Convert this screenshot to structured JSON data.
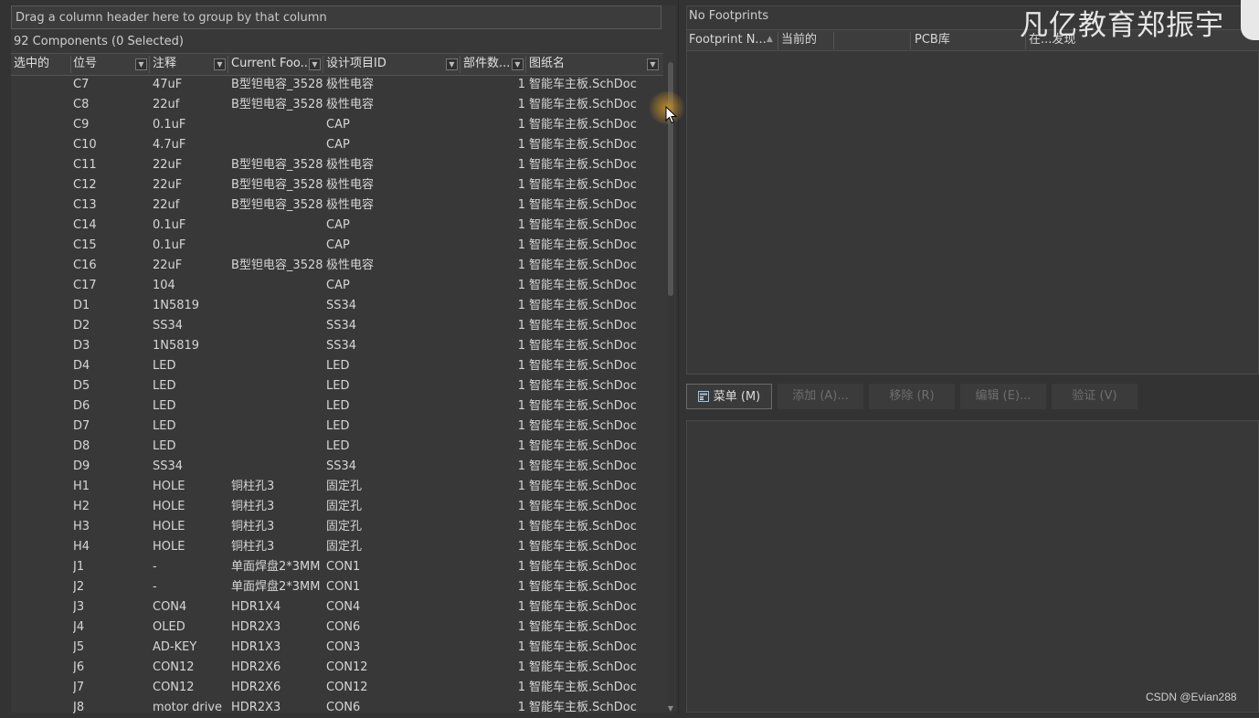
{
  "left": {
    "group_hint": "Drag a column header here to group by that column",
    "count": "92 Components (0 Selected)",
    "columns": [
      "选中的",
      "位号",
      "注释",
      "Current Foo...",
      "设计项目ID",
      "部件数...",
      "图纸名"
    ],
    "rows": [
      [
        "",
        "C7",
        "47uF",
        "B型钽电容_3528",
        "极性电容",
        "1",
        "智能车主板.SchDoc"
      ],
      [
        "",
        "C8",
        "22uf",
        "B型钽电容_3528",
        "极性电容",
        "1",
        "智能车主板.SchDoc"
      ],
      [
        "",
        "C9",
        "0.1uF",
        "",
        "CAP",
        "1",
        "智能车主板.SchDoc"
      ],
      [
        "",
        "C10",
        "4.7uF",
        "",
        "CAP",
        "1",
        "智能车主板.SchDoc"
      ],
      [
        "",
        "C11",
        "22uF",
        "B型钽电容_3528",
        "极性电容",
        "1",
        "智能车主板.SchDoc"
      ],
      [
        "",
        "C12",
        "22uF",
        "B型钽电容_3528",
        "极性电容",
        "1",
        "智能车主板.SchDoc"
      ],
      [
        "",
        "C13",
        "22uf",
        "B型钽电容_3528",
        "极性电容",
        "1",
        "智能车主板.SchDoc"
      ],
      [
        "",
        "C14",
        "0.1uF",
        "",
        "CAP",
        "1",
        "智能车主板.SchDoc"
      ],
      [
        "",
        "C15",
        "0.1uF",
        "",
        "CAP",
        "1",
        "智能车主板.SchDoc"
      ],
      [
        "",
        "C16",
        "22uF",
        "B型钽电容_3528",
        "极性电容",
        "1",
        "智能车主板.SchDoc"
      ],
      [
        "",
        "C17",
        "104",
        "",
        "CAP",
        "1",
        "智能车主板.SchDoc"
      ],
      [
        "",
        "D1",
        "1N5819",
        "",
        "SS34",
        "1",
        "智能车主板.SchDoc"
      ],
      [
        "",
        "D2",
        "SS34",
        "",
        "SS34",
        "1",
        "智能车主板.SchDoc"
      ],
      [
        "",
        "D3",
        "1N5819",
        "",
        "SS34",
        "1",
        "智能车主板.SchDoc"
      ],
      [
        "",
        "D4",
        "LED",
        "",
        "LED",
        "1",
        "智能车主板.SchDoc"
      ],
      [
        "",
        "D5",
        "LED",
        "",
        "LED",
        "1",
        "智能车主板.SchDoc"
      ],
      [
        "",
        "D6",
        "LED",
        "",
        "LED",
        "1",
        "智能车主板.SchDoc"
      ],
      [
        "",
        "D7",
        "LED",
        "",
        "LED",
        "1",
        "智能车主板.SchDoc"
      ],
      [
        "",
        "D8",
        "LED",
        "",
        "LED",
        "1",
        "智能车主板.SchDoc"
      ],
      [
        "",
        "D9",
        "SS34",
        "",
        "SS34",
        "1",
        "智能车主板.SchDoc"
      ],
      [
        "",
        "H1",
        "HOLE",
        "铜柱孔3",
        "固定孔",
        "1",
        "智能车主板.SchDoc"
      ],
      [
        "",
        "H2",
        "HOLE",
        "铜柱孔3",
        "固定孔",
        "1",
        "智能车主板.SchDoc"
      ],
      [
        "",
        "H3",
        "HOLE",
        "铜柱孔3",
        "固定孔",
        "1",
        "智能车主板.SchDoc"
      ],
      [
        "",
        "H4",
        "HOLE",
        "铜柱孔3",
        "固定孔",
        "1",
        "智能车主板.SchDoc"
      ],
      [
        "",
        "J1",
        "-",
        "单面焊盘2*3MM",
        "CON1",
        "1",
        "智能车主板.SchDoc"
      ],
      [
        "",
        "J2",
        "-",
        "单面焊盘2*3MM",
        "CON1",
        "1",
        "智能车主板.SchDoc"
      ],
      [
        "",
        "J3",
        "CON4",
        "HDR1X4",
        "CON4",
        "1",
        "智能车主板.SchDoc"
      ],
      [
        "",
        "J4",
        "OLED",
        "HDR2X3",
        "CON6",
        "1",
        "智能车主板.SchDoc"
      ],
      [
        "",
        "J5",
        "AD-KEY",
        "HDR1X3",
        "CON3",
        "1",
        "智能车主板.SchDoc"
      ],
      [
        "",
        "J6",
        "CON12",
        "HDR2X6",
        "CON12",
        "1",
        "智能车主板.SchDoc"
      ],
      [
        "",
        "J7",
        "CON12",
        "HDR2X6",
        "CON12",
        "1",
        "智能车主板.SchDoc"
      ],
      [
        "",
        "J8",
        "motor drive",
        "HDR2X3",
        "CON6",
        "1",
        "智能车主板.SchDoc"
      ]
    ]
  },
  "right": {
    "no_footprints": "No Footprints",
    "columns": [
      "Footprint N...",
      "当前的",
      "PCB库",
      "在...发现"
    ],
    "buttons": {
      "menu": "菜单 (M)",
      "add": "添加 (A)...",
      "remove": "移除 (R)",
      "edit": "编辑 (E)...",
      "validate": "验证 (V)"
    }
  },
  "watermark": "凡亿教育郑振宇",
  "credit": "CSDN @Evian288"
}
